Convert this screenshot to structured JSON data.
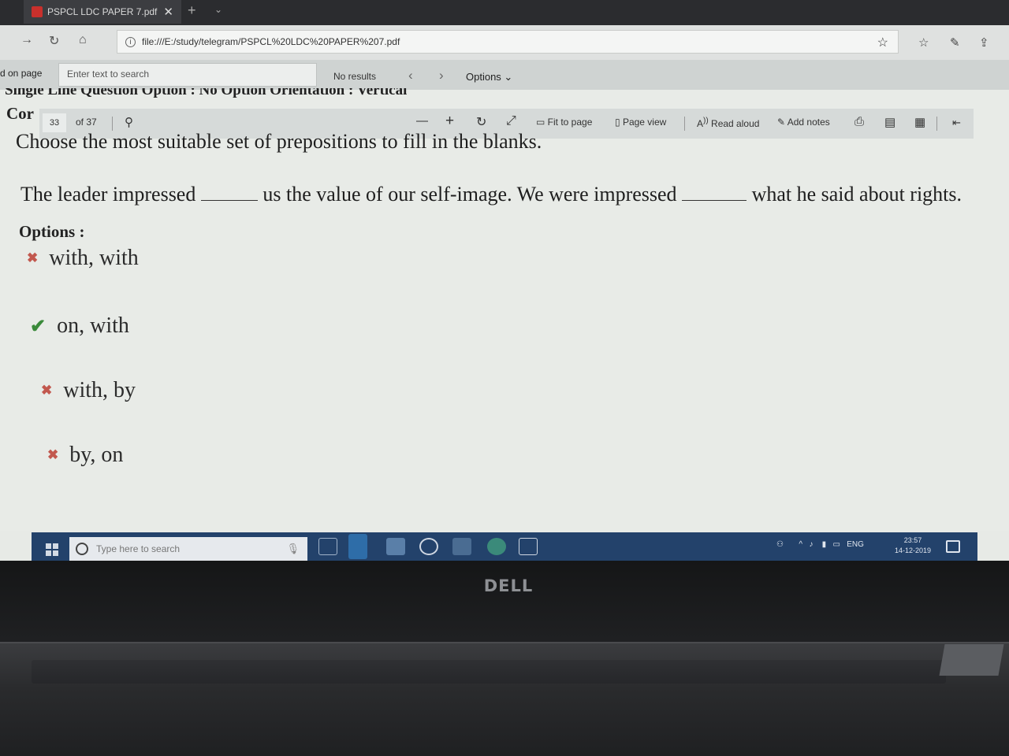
{
  "browser": {
    "tab_title": "PSPCL LDC PAPER 7.pdf",
    "tab_close": "✕",
    "new_tab": "+",
    "tab_menu": "⌄",
    "address": "file:///E:/study/telegram/PSPCL%20LDC%20PAPER%207.pdf",
    "nav": {
      "back": "←",
      "forward": "→",
      "refresh": "↻",
      "home": "⌂"
    },
    "favorite_icon": "star-icon"
  },
  "findbar": {
    "label": "d on page",
    "placeholder": "Enter text to search",
    "results": "No results",
    "prev": "‹",
    "next": "›",
    "options": "Options ⌄"
  },
  "pdf_toolbar": {
    "page_number": "33",
    "page_total": "of 37",
    "zoom_out": "—",
    "zoom_in": "+",
    "rotate": "↻",
    "fullscreen": "⤢",
    "fit_to_page": "Fit to page",
    "page_view": "Page view",
    "read_aloud": "Read aloud",
    "add_notes": "Add notes"
  },
  "document": {
    "cut_header": "Single Line Question Option : No Option Orientation : Vertical",
    "cor_label": "Cor",
    "question": "Choose the most suitable set of prepositions to fill in the blanks.",
    "sentence_part1": "The leader impressed",
    "sentence_part2": "us the value of our self-image. We were impressed",
    "sentence_part3": "what he said about rights.",
    "options_label": "Options :",
    "options": [
      {
        "text": "with, with",
        "mark": "✖"
      },
      {
        "text": "on, with",
        "mark": "✔"
      },
      {
        "text": "with, by",
        "mark": "✖"
      },
      {
        "text": "by, on",
        "mark": "✖"
      }
    ]
  },
  "taskbar": {
    "search_placeholder": "Type here to search",
    "language": "ENG",
    "time": "23:57",
    "date": "14-12-2019"
  },
  "device": {
    "brand": "DELL"
  },
  "colors": {
    "correct": "#3a8a3a",
    "wrong": "#c2584e",
    "taskbar": "#23426b"
  }
}
